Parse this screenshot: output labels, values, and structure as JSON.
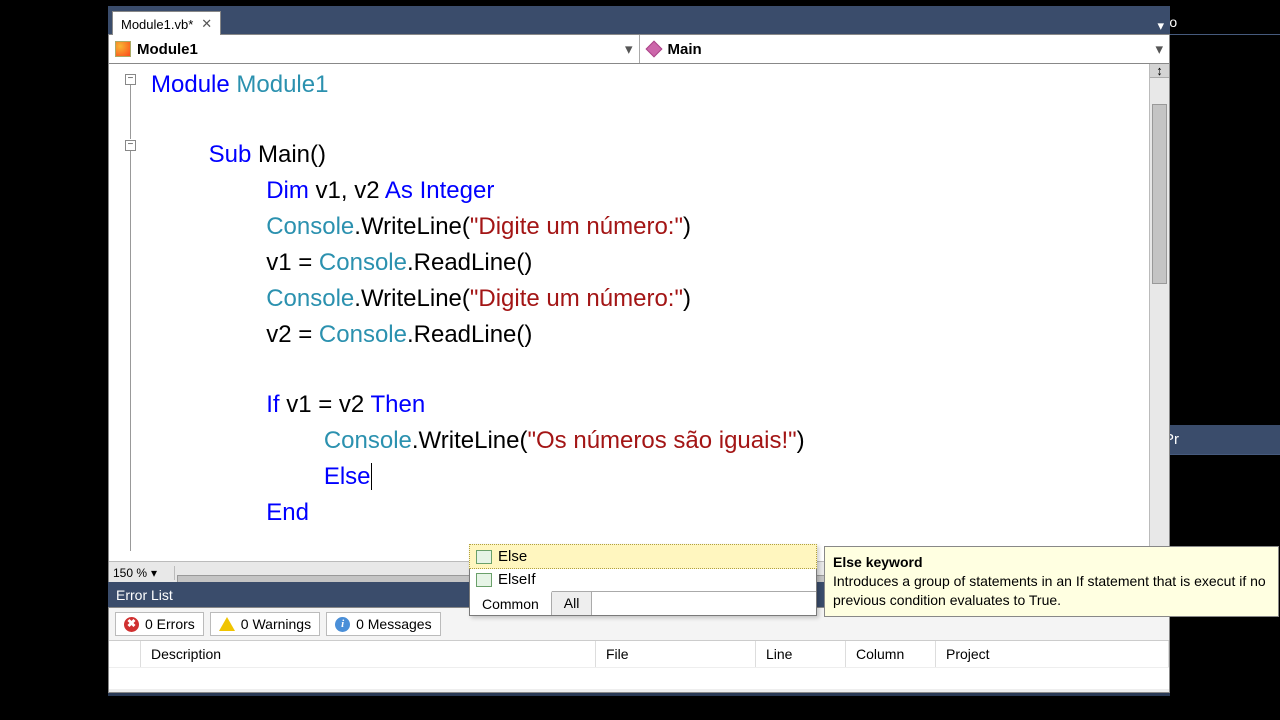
{
  "sidepanel": {
    "title": "So"
  },
  "prpanel": {
    "title": "Pr"
  },
  "tab": {
    "label": "Module1.vb*",
    "close": "✕"
  },
  "nav": {
    "left": "Module1",
    "right": "Main"
  },
  "zoom": {
    "value": "150 %"
  },
  "code": {
    "l1_kw": "Module",
    "l1_ty": " Module1",
    "l2_kw": "Sub",
    "l2_plain": " Main()",
    "l3_kw1": "Dim",
    "l3_plain": " v1, v2 ",
    "l3_kw2": "As Integer",
    "l4_a": "Console",
    "l4_b": ".WriteLine(",
    "l4_s": "\"Digite um número:\"",
    "l4_c": ")",
    "l5_a": "v1 = ",
    "l5_b": "Console",
    "l5_c": ".ReadLine()",
    "l6_a": "Console",
    "l6_b": ".WriteLine(",
    "l6_s": "\"Digite um número:\"",
    "l6_c": ")",
    "l7_a": "v2 = ",
    "l7_b": "Console",
    "l7_c": ".ReadLine()",
    "l8_kw1": "If",
    "l8_plain": " v1 = v2 ",
    "l8_kw2": "Then",
    "l9_a": "Console",
    "l9_b": ".WriteLine(",
    "l9_s": "\"Os números são iguais!\"",
    "l9_c": ")",
    "l10_kw": "Else",
    "l11_kw": "End"
  },
  "intelli": {
    "items": [
      {
        "label": "Else"
      },
      {
        "label": "ElseIf"
      }
    ],
    "tabs": {
      "common": "Common",
      "all": "All"
    }
  },
  "tooltip": {
    "title": "Else keyword",
    "body": "Introduces a group of statements in an If statement that is execut if no previous condition evaluates to True."
  },
  "errorlist": {
    "title": "Error List",
    "errors": "0 Errors",
    "warnings": "0 Warnings",
    "messages": "0 Messages",
    "cols": {
      "desc": "Description",
      "file": "File",
      "line": "Line",
      "col": "Column",
      "proj": "Project"
    }
  }
}
